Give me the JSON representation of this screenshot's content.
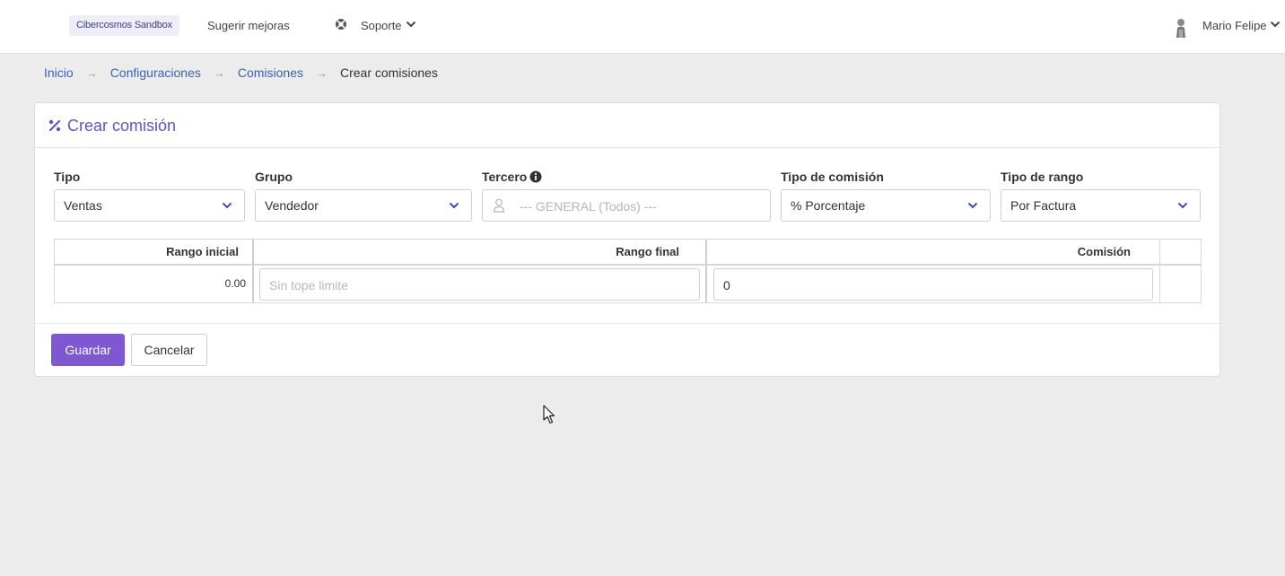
{
  "topbar": {
    "env_badge": "Cibercosmos Sandbox",
    "suggest_link": "Sugerir mejoras",
    "support_link": "Soporte",
    "user_name": "Mario Felipe"
  },
  "breadcrumb": {
    "items": [
      "Inicio",
      "Configuraciones",
      "Comisiones"
    ],
    "separator": "→",
    "current": "Crear comisiones"
  },
  "card": {
    "title": "Crear comisión",
    "fields": {
      "tipo": {
        "label": "Tipo",
        "value": "Ventas"
      },
      "grupo": {
        "label": "Grupo",
        "value": "Vendedor"
      },
      "tercero": {
        "label": "Tercero",
        "placeholder": "--- GENERAL (Todos) ---"
      },
      "tipo_comision": {
        "label": "Tipo de comisión",
        "value": "% Porcentaje"
      },
      "tipo_rango": {
        "label": "Tipo de rango",
        "value": "Por Factura"
      }
    },
    "table": {
      "headers": [
        "Rango inicial",
        "Rango final",
        "Comisión"
      ],
      "row": {
        "rango_inicial": "0.00",
        "rango_final_placeholder": "Sin tope limite",
        "comision": "0"
      }
    },
    "buttons": {
      "save": "Guardar",
      "cancel": "Cancelar"
    }
  },
  "colors": {
    "accent": "#7e57d3",
    "title": "#5b57c8",
    "link": "#3a62b8",
    "background": "#ebeceb"
  }
}
